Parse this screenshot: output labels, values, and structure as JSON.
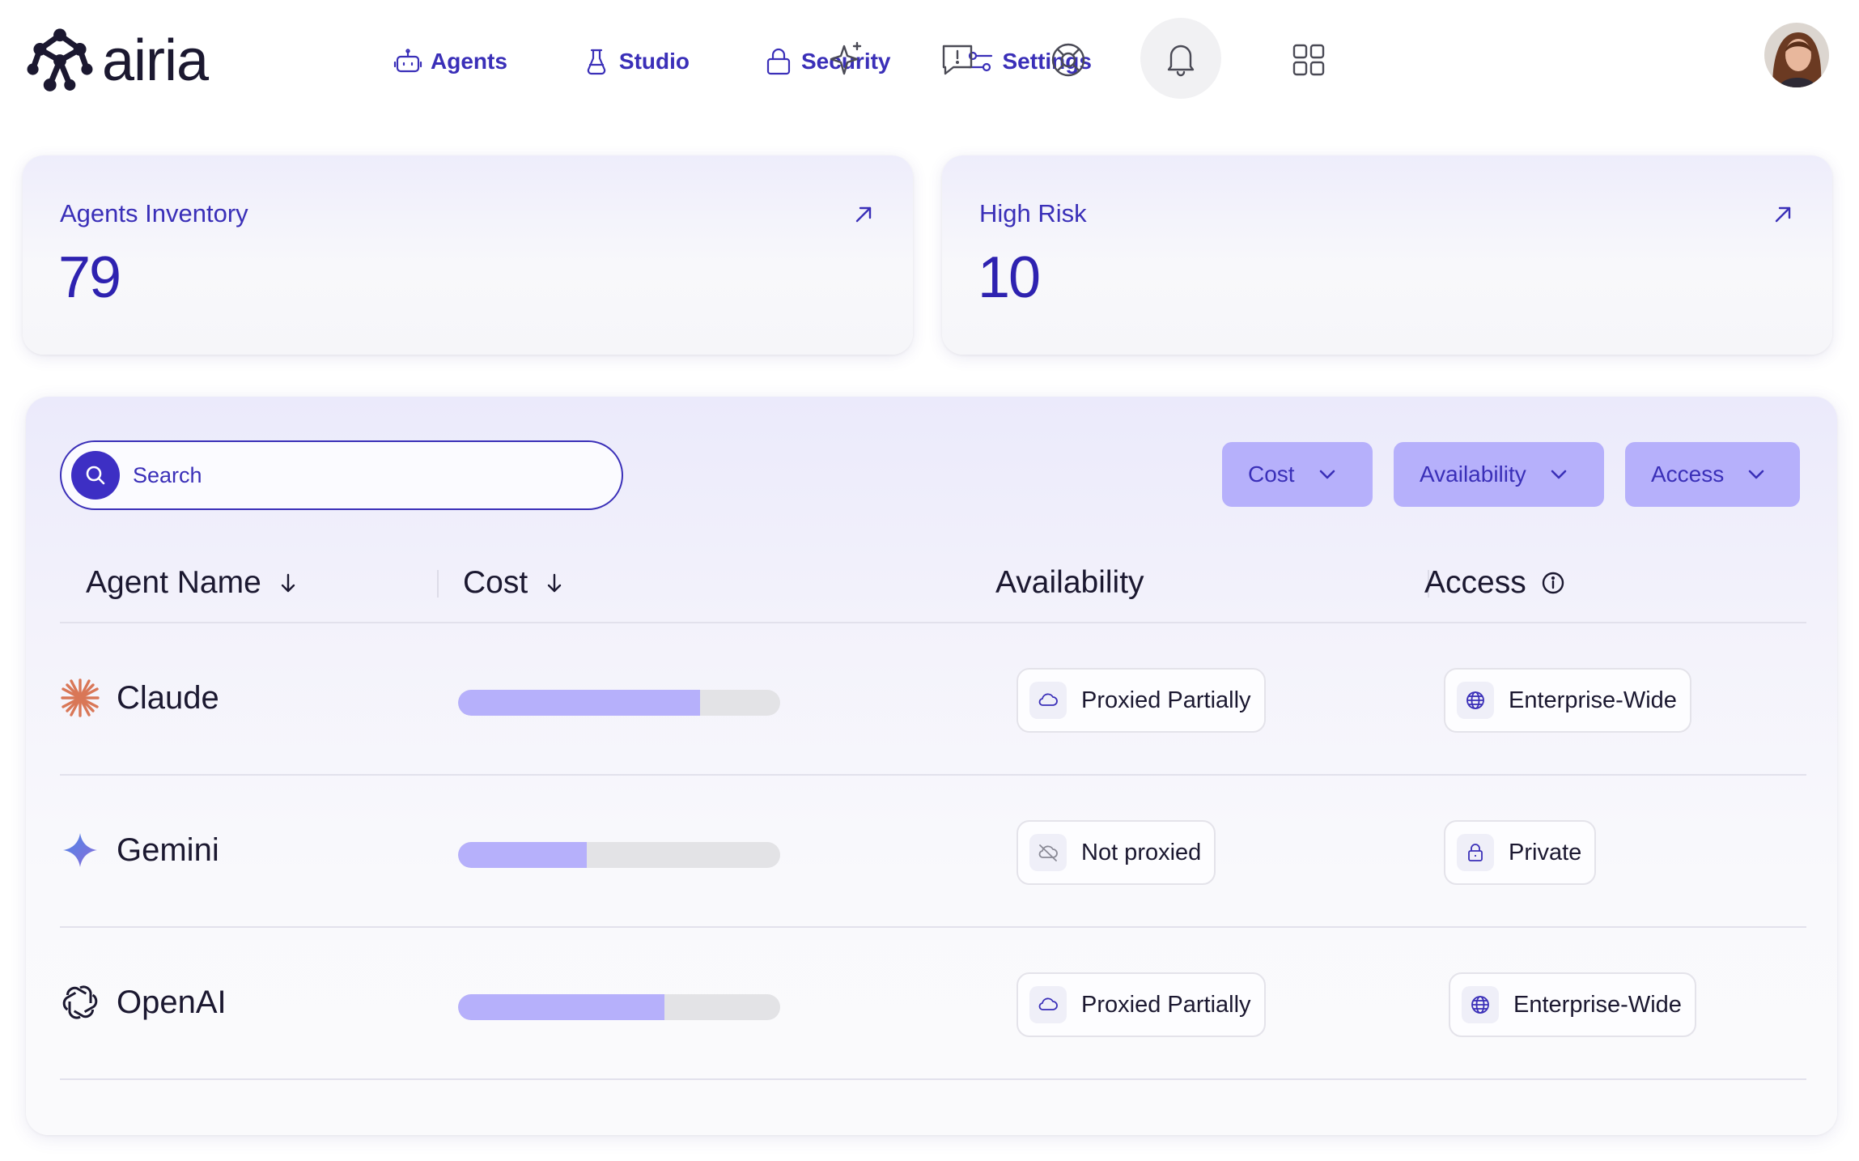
{
  "app": {
    "name": "airia"
  },
  "nav": [
    {
      "label": "Agents",
      "icon": "robot-icon"
    },
    {
      "label": "Studio",
      "icon": "flask-icon"
    },
    {
      "label": "Security",
      "icon": "lock-icon"
    },
    {
      "label": "Settings",
      "icon": "sliders-icon"
    }
  ],
  "top_icons": [
    "sparkle-icon",
    "feedback-icon",
    "help-lifebuoy-icon",
    "bell-icon",
    "apps-grid-icon",
    "avatar"
  ],
  "stats": [
    {
      "label": "Agents Inventory",
      "value": "79"
    },
    {
      "label": "High Risk",
      "value": "10"
    }
  ],
  "search": {
    "placeholder": "Search"
  },
  "filters": [
    {
      "label": "Cost"
    },
    {
      "label": "Availability"
    },
    {
      "label": "Access"
    }
  ],
  "table": {
    "headers": {
      "agent_name": "Agent Name",
      "cost": "Cost",
      "availability": "Availability",
      "access": "Access"
    },
    "rows": [
      {
        "name": "Claude",
        "logo": "claude-logo-icon",
        "cost_fraction": 0.75,
        "availability": "Proxied Partially",
        "availability_icon": "cloud-icon",
        "access": "Enterprise-Wide",
        "access_icon": "globe-icon"
      },
      {
        "name": "Gemini",
        "logo": "gemini-logo-icon",
        "cost_fraction": 0.4,
        "availability": "Not proxied",
        "availability_icon": "cloud-off-icon",
        "access": "Private",
        "access_icon": "lock-icon"
      },
      {
        "name": "OpenAI",
        "logo": "openai-logo-icon",
        "cost_fraction": 0.64,
        "availability": "Proxied Partially",
        "availability_icon": "cloud-icon",
        "access": "Enterprise-Wide",
        "access_icon": "globe-icon"
      }
    ]
  },
  "colors": {
    "accent": "#3a2fb8",
    "accent_strong": "#3d2fc4",
    "accent_soft": "#b6b0fb",
    "track": "#e3e3e6",
    "claude": "#d97757",
    "gemini": "#5b6bd8"
  }
}
